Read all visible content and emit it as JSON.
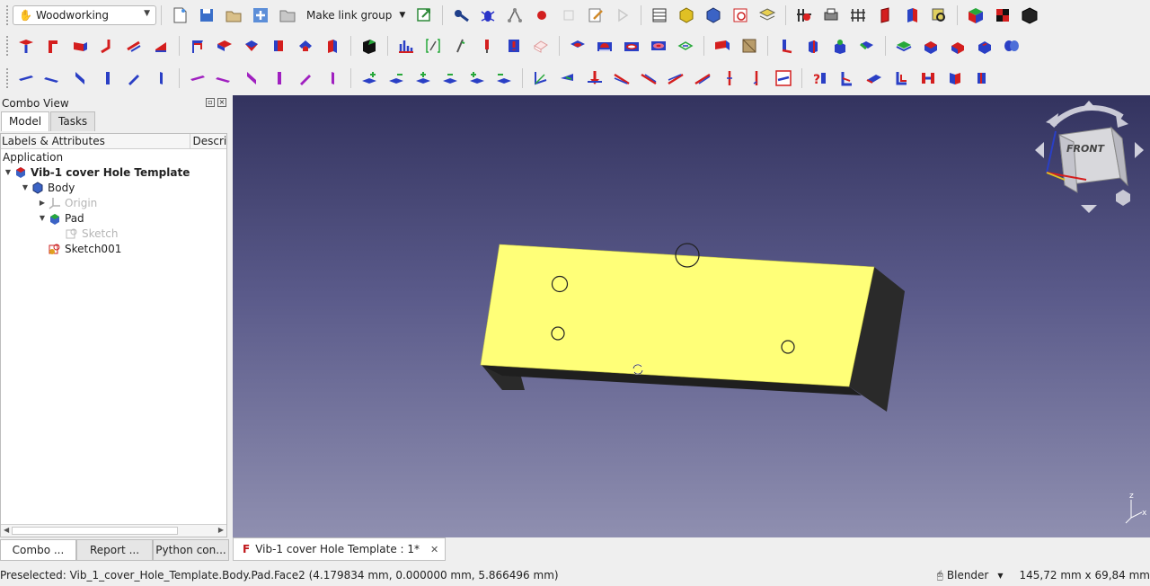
{
  "toolbar": {
    "workbench": "Woodworking",
    "link_group_label": "Make link group"
  },
  "combo_view": {
    "title": "Combo View",
    "tabs": [
      "Model",
      "Tasks"
    ],
    "columns": [
      "Labels & Attributes",
      "Descri"
    ],
    "tree": {
      "root": "Application",
      "document": "Vib-1 cover Hole Template",
      "body": "Body",
      "origin": "Origin",
      "pad": "Pad",
      "sketch": "Sketch",
      "sketch001": "Sketch001"
    },
    "bottom_tabs": [
      "Combo ...",
      "Report ...",
      "Python con..."
    ]
  },
  "document_tab": {
    "label": "Vib-1 cover Hole Template : 1*"
  },
  "navcube": {
    "face_label": "FRONT"
  },
  "statusbar": {
    "preselected": "Preselected: Vib_1_cover_Hole_Template.Body.Pad.Face2 (4.179834 mm, 0.000000 mm, 5.866496 mm)",
    "navigation_style": "Blender",
    "dimensions": "145,72 mm x 69,84 mm"
  },
  "colors": {
    "face": "#ffff78",
    "side": "#2a2a2a",
    "viewport_top": "#33335f",
    "viewport_bottom": "#8f8fb0"
  }
}
